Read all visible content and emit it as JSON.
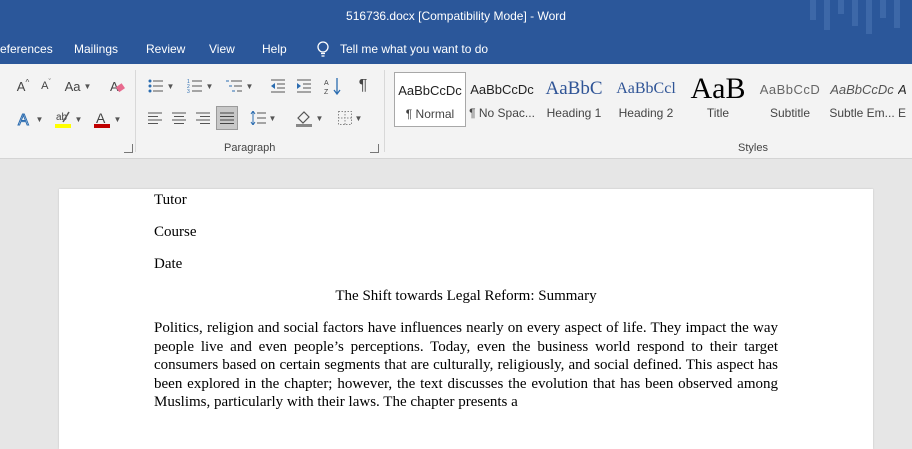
{
  "window": {
    "title": "516736.docx [Compatibility Mode]  -  Word"
  },
  "menu": {
    "tabs": [
      "eferences",
      "Mailings",
      "Review",
      "View",
      "Help"
    ],
    "tell_me": "Tell me what you want to do"
  },
  "ribbon": {
    "font_group": {
      "grow": "A",
      "shrink": "A",
      "change_case": "Aa"
    },
    "paragraph_label": "Paragraph",
    "styles_label": "Styles",
    "styles": [
      {
        "preview": "AaBbCcDc",
        "name": "¶ Normal"
      },
      {
        "preview": "AaBbCcDc",
        "name": "¶ No Spac..."
      },
      {
        "preview": "AaBbC",
        "name": "Heading 1"
      },
      {
        "preview": "AaBbCcl",
        "name": "Heading 2"
      },
      {
        "preview": "AaB",
        "name": "Title"
      },
      {
        "preview": "AaBbCcD",
        "name": "Subtitle"
      },
      {
        "preview": "AaBbCcDc",
        "name": "Subtle Em..."
      },
      {
        "preview": "A",
        "name": "E"
      }
    ]
  },
  "document": {
    "lines": [
      "Tutor",
      "Course",
      "Date"
    ],
    "heading": "The Shift towards Legal Reform: Summary",
    "paragraph": "Politics, religion and social factors have influences nearly on every aspect of life. They impact the way people live and even people’s perceptions. Today, even the business world respond to their target consumers based on certain segments that are culturally, religiously, and social defined. This aspect has been explored in the chapter; however, the text discusses the evolution that has been observed among Muslims, particularly with their laws. The chapter presents a"
  },
  "colors": {
    "accent": "#2b579a",
    "highlight": "#ffff00",
    "font_color": "#c00000"
  }
}
